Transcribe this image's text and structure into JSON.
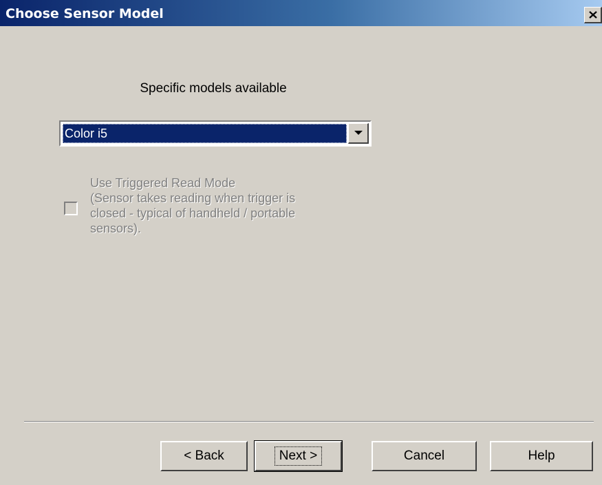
{
  "window": {
    "title": "Choose Sensor Model",
    "close_icon": "close-icon"
  },
  "main": {
    "heading": "Specific models available",
    "model_select": {
      "selected": "Color i5",
      "arrow_icon": "chevron-down-icon"
    },
    "triggered_mode": {
      "checked": false,
      "enabled": false,
      "label_lines": [
        "Use Triggered Read Mode",
        "(Sensor takes reading when trigger is",
        "closed - typical of handheld / portable",
        "sensors)."
      ]
    }
  },
  "footer": {
    "back_label": "< Back",
    "next_label": "Next >",
    "cancel_label": "Cancel",
    "help_label": "Help"
  },
  "colors": {
    "title_gradient_start": "#0a246a",
    "title_gradient_end": "#a6caf0",
    "face": "#d4d0c8",
    "selection": "#0a246a",
    "disabled_text": "#808080"
  }
}
